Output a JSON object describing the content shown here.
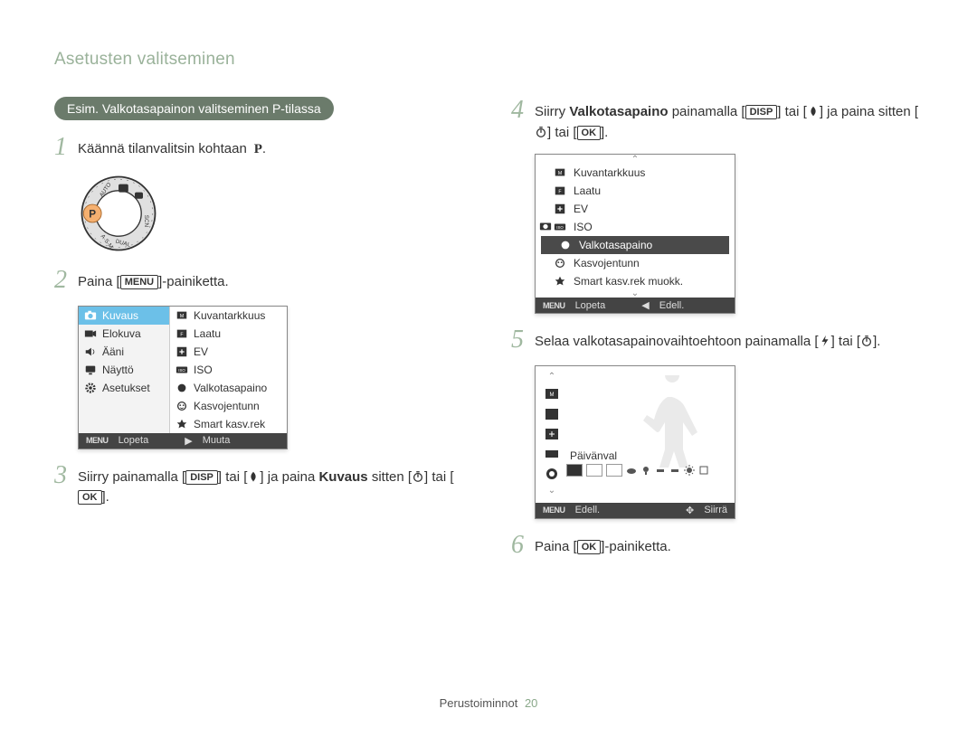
{
  "header": "Asetusten valitseminen",
  "pill": "Esim. Valkotasapainon valitseminen P-tilassa",
  "steps": {
    "s1": {
      "num": "1",
      "text_a": "Käännä tilanvalitsin kohtaan",
      "text_b": "."
    },
    "s2": {
      "num": "2",
      "text_a": "Paina [",
      "menu": "MENU",
      "text_b": "]-painiketta."
    },
    "s3": {
      "num": "3",
      "text_a": "Siirry painamalla [",
      "disp": "DISP",
      "text_b": "] tai [",
      "text_c": "] ja paina ",
      "bold": "Kuvaus",
      "text_d": " sitten [",
      "text_e": "] tai [",
      "ok": "OK",
      "text_f": "]."
    },
    "s4": {
      "num": "4",
      "text_a": "Siirry ",
      "bold": "Valkotasapaino",
      "text_b": " painamalla [",
      "disp": "DISP",
      "text_c": "] tai [",
      "text_d": "] ja paina sitten [",
      "text_e": "] tai [",
      "ok": "OK",
      "text_f": "]."
    },
    "s5": {
      "num": "5",
      "text_a": "Selaa valkotasapainovaihtoehtoon painamalla [",
      "text_b": "] tai [",
      "text_c": "]."
    },
    "s6": {
      "num": "6",
      "text_a": "Paina [",
      "ok": "OK",
      "text_b": "]-painiketta."
    }
  },
  "screenA": {
    "left": [
      "Kuvaus",
      "Elokuva",
      "Ääni",
      "Näyttö",
      "Asetukset"
    ],
    "right": [
      "Kuvantarkkuus",
      "Laatu",
      "EV",
      "ISO",
      "Valkotasapaino",
      "Kasvojentunn",
      "Smart kasv.rek"
    ],
    "footer": {
      "left": "Lopeta",
      "right": "Muuta",
      "menu": "MENU"
    }
  },
  "screenB": {
    "items": [
      "Kuvantarkkuus",
      "Laatu",
      "EV",
      "ISO",
      "Valkotasapaino",
      "Kasvojentunn",
      "Smart kasv.rek muokk."
    ],
    "footer": {
      "left": "Lopeta",
      "right": "Edell.",
      "menu": "MENU"
    }
  },
  "screenC": {
    "label": "Päivänval",
    "footer": {
      "left": "Edell.",
      "right": "Siirrä",
      "menu": "MENU"
    }
  },
  "footer": {
    "label": "Perustoiminnot",
    "page": "20"
  }
}
